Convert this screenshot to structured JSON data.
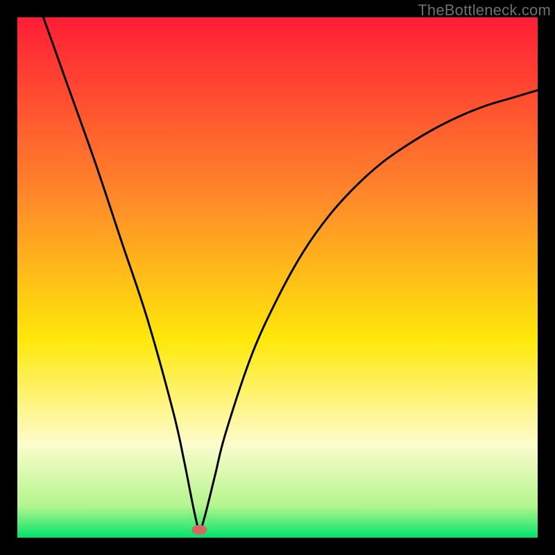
{
  "watermark": "TheBottleneck.com",
  "colors": {
    "top": "#ff1d36",
    "mid_upper": "#ff8a2a",
    "mid": "#ffe80a",
    "mid_lower": "#fdfccd",
    "near_bottom": "#b3f58e",
    "bottom": "#00e36a",
    "curve": "#000000",
    "marker": "#d36a62",
    "frame": "#000000"
  },
  "chart_data": {
    "type": "line",
    "title": "",
    "xlabel": "",
    "ylabel": "",
    "xlim": [
      0,
      100
    ],
    "ylim": [
      0,
      100
    ],
    "minimum_at_x": 35,
    "annotations": [],
    "series": [
      {
        "name": "bottleneck-curve",
        "x": [
          5,
          10,
          15,
          20,
          25,
          30,
          32,
          34,
          35,
          36,
          38,
          40,
          45,
          50,
          55,
          60,
          65,
          70,
          75,
          80,
          85,
          90,
          95,
          100
        ],
        "y": [
          100,
          86,
          72,
          57,
          42,
          24,
          15,
          5,
          1.5,
          4,
          12,
          20,
          35,
          46,
          55,
          62,
          67.5,
          72,
          75.5,
          78.5,
          81,
          83,
          84.5,
          86
        ]
      }
    ],
    "marker": {
      "x": 35,
      "y": 1.5
    }
  }
}
